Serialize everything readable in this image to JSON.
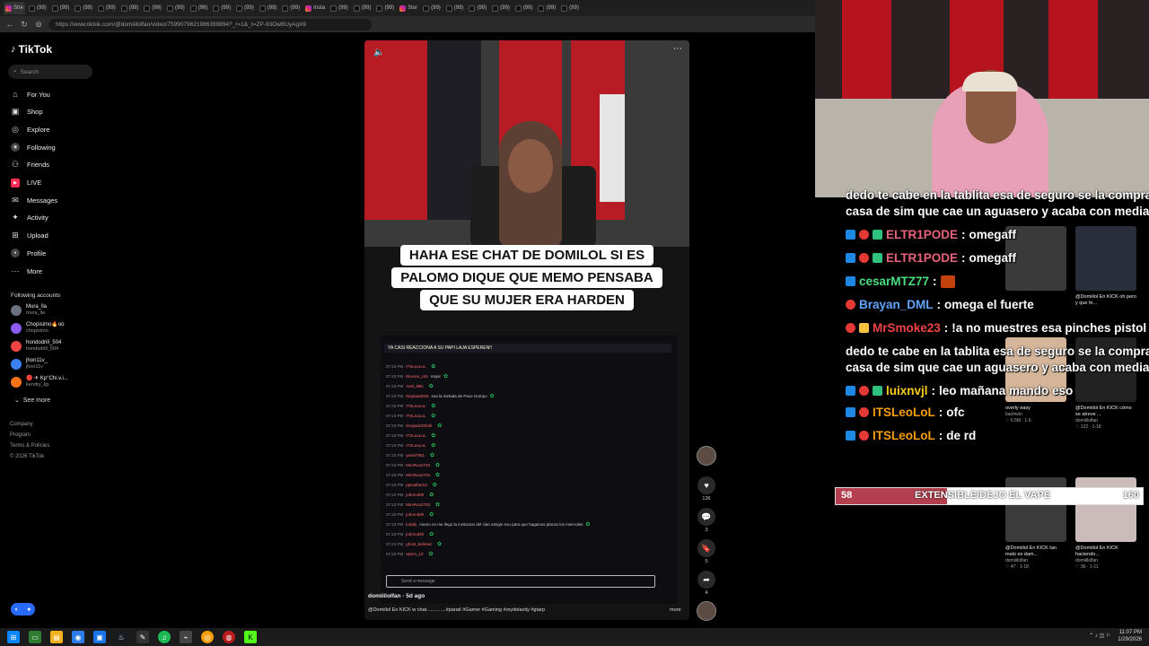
{
  "browser": {
    "tabs": [
      {
        "label": "Stre",
        "fav": "ig"
      },
      {
        "label": "(99)",
        "fav": "tt"
      },
      {
        "label": "(99)",
        "fav": "tt"
      },
      {
        "label": "(99)",
        "fav": "tt"
      },
      {
        "label": "(99)",
        "fav": "tt"
      },
      {
        "label": "(99)",
        "fav": "tt"
      },
      {
        "label": "(99)",
        "fav": "tt"
      },
      {
        "label": "(99)",
        "fav": "tt"
      },
      {
        "label": "(99)",
        "fav": "tt"
      },
      {
        "label": "(99)",
        "fav": "tt"
      },
      {
        "label": "(99)",
        "fav": "tt"
      },
      {
        "label": "(99)",
        "fav": "tt"
      },
      {
        "label": "(99)",
        "fav": "tt"
      },
      {
        "label": "Insta",
        "fav": "ig"
      },
      {
        "label": "(99)",
        "fav": "tt"
      },
      {
        "label": "(99)",
        "fav": "tt"
      },
      {
        "label": "(99)",
        "fav": "tt"
      },
      {
        "label": "Stor",
        "fav": "ig"
      },
      {
        "label": "(99)",
        "fav": "tt"
      },
      {
        "label": "(99)",
        "fav": "tt"
      },
      {
        "label": "(99)",
        "fav": "tt"
      },
      {
        "label": "(99)",
        "fav": "tt"
      },
      {
        "label": "(99)",
        "fav": "tt"
      },
      {
        "label": "(99)",
        "fav": "tt"
      },
      {
        "label": "(99)",
        "fav": "tt"
      }
    ],
    "url": "https://www.tiktok.com/@domiiilolfan/video/7599079621986399894?_r=1&_t=ZP-93OwBUyAgX9"
  },
  "sidebar": {
    "logo": "TikTok",
    "search_placeholder": "Search",
    "nav": [
      {
        "label": "For You",
        "icon": "home-icon",
        "glyph": "⌂"
      },
      {
        "label": "Shop",
        "icon": "shop-icon",
        "glyph": "▣"
      },
      {
        "label": "Explore",
        "icon": "compass-icon",
        "glyph": "◎"
      },
      {
        "label": "Following",
        "icon": "following-icon",
        "glyph": "◉"
      },
      {
        "label": "Friends",
        "icon": "friends-icon",
        "glyph": "⚇"
      },
      {
        "label": "LIVE",
        "icon": "live-icon",
        "glyph": "▶"
      },
      {
        "label": "Messages",
        "icon": "messages-icon",
        "glyph": "✉"
      },
      {
        "label": "Activity",
        "icon": "activity-icon",
        "glyph": "✦"
      },
      {
        "label": "Upload",
        "icon": "upload-icon",
        "glyph": "⊞"
      },
      {
        "label": "Profile",
        "icon": "profile-icon",
        "glyph": "●"
      },
      {
        "label": "More",
        "icon": "more-icon",
        "glyph": "⋯"
      }
    ],
    "following_title": "Following accounts",
    "accounts": [
      {
        "name": "Mura_lla",
        "handle": "mura_lla"
      },
      {
        "name": "Chopisimo🔥oo",
        "handle": "chopisimo"
      },
      {
        "name": "hondodrill_504",
        "handle": "hondodrill_504"
      },
      {
        "name": "jhon11v_",
        "handle": "jhon11v"
      },
      {
        "name": "🔴 ✈ Kp°Chi.v.i...",
        "handle": "kendry_kp"
      }
    ],
    "see_more": "See more",
    "footer": [
      "Company",
      "Program",
      "Terms & Policies",
      "© 2026 TikTok"
    ]
  },
  "video": {
    "caption_lines": [
      "HAHA ESE CHAT DE DOMILOL SI ES",
      "PALOMO DIQUE QUE MEMO PENSABA",
      "QUE SU MUJER ERA HARDEN"
    ],
    "chat_banner": "YA CASI REACCIONA A SU PAPI LAJA ESPEREN!!",
    "chat_lines": [
      {
        "t": "07:23 PM",
        "u": "ITSLeoLoL",
        "m": ""
      },
      {
        "t": "07:23 PM",
        "u": "Elcesar_csb",
        "m": "mejor"
      },
      {
        "t": "07:23 PM",
        "u": "Axel_99lc",
        "m": ""
      },
      {
        "t": "07:23 PM",
        "u": "Ninjaaa0028",
        "m": "esa la mirtada de Pace Gompo"
      },
      {
        "t": "07:23 PM",
        "u": "ITSLeoLoL",
        "m": ""
      },
      {
        "t": "07:23 PM",
        "u": "ITSLeoLoL",
        "m": ""
      },
      {
        "t": "07:23 PM",
        "u": "Dropatiz2004k",
        "m": ""
      },
      {
        "t": "07:23 PM",
        "u": "ITSLeoLoL",
        "m": ""
      },
      {
        "t": "07:23 PM",
        "u": "ITSLeoLoL",
        "m": ""
      },
      {
        "t": "07:23 PM",
        "u": "yeriel7951",
        "m": ""
      },
      {
        "t": "07:23 PM",
        "u": "MirvRoo2703",
        "m": ""
      },
      {
        "t": "07:23 PM",
        "u": "MirvRoo2703",
        "m": ""
      },
      {
        "t": "07:23 PM",
        "u": "pptvalbertot",
        "m": ""
      },
      {
        "t": "07:23 PM",
        "u": "juhrnnd9h",
        "m": ""
      },
      {
        "t": "07:23 PM",
        "u": "MirvRoo2703",
        "m": ""
      },
      {
        "t": "07:23 PM",
        "u": "juhrnnd9h",
        "m": ""
      },
      {
        "t": "07:23 PM",
        "u": "luisvlij",
        "m": "memo no me llego la invitacion del clan amiglo eso para que hagamos placas los miercoles"
      },
      {
        "t": "07:23 PM",
        "u": "juhrnnd9h",
        "m": ""
      },
      {
        "t": "07:23 PM",
        "u": "ghost_beltrear",
        "m": ""
      },
      {
        "t": "07:23 PM",
        "u": "wjmm_10",
        "m": ""
      }
    ],
    "msg_placeholder": "Send a message",
    "author": "domiiilolfan · 5d ago",
    "description": "@Domiilol En KICK w chat..............#paratí #Gamer #Gaming #reydelacity #gtarp",
    "more": "more"
  },
  "rail": {
    "likes": "136",
    "comments": "3",
    "saves": "5",
    "shares": "4"
  },
  "overlay_chat": [
    {
      "name": "",
      "msg": "dedo te cabe en la tablita esa de seguro se la compras",
      "badges": [],
      "color": "#ffffff"
    },
    {
      "name": "",
      "msg": "casa de sim que cae un aguasero y acaba con media is",
      "badges": [],
      "color": "#ffffff"
    },
    {
      "name": "ELTR1PODE",
      "msg": "omegaff",
      "badges": [
        "b1",
        "b2",
        "b3"
      ],
      "color": "#e8637b"
    },
    {
      "name": "ELTR1PODE",
      "msg": "omegaff",
      "badges": [
        "b1",
        "b2",
        "b3"
      ],
      "color": "#e8637b"
    },
    {
      "name": "cesarMTZ77",
      "msg": "",
      "badges": [
        "b1"
      ],
      "color": "#4ade80"
    },
    {
      "name": "Brayan_DML",
      "msg": "omega el fuerte",
      "badges": [
        "b2"
      ],
      "color": "#60a5fa"
    },
    {
      "name": "MrSmoke23",
      "msg": "!a no muestres esa pinches pistol",
      "badges": [
        "b2",
        "b4"
      ],
      "color": "#ef4444"
    },
    {
      "name": "",
      "msg": "dedo te cabe en la tablita esa de seguro se la compras",
      "badges": [],
      "color": "#ffffff"
    },
    {
      "name": "",
      "msg": "casa de sim que cae un aguasero y acaba con media is",
      "badges": [],
      "color": "#ffffff"
    },
    {
      "name": "luixnvjl",
      "msg": "leo mañana mando eso",
      "badges": [
        "b1",
        "b2",
        "b3"
      ],
      "color": "#facc15"
    },
    {
      "name": "ITSLeoLoL",
      "msg": "ofc",
      "badges": [
        "b1",
        "b2"
      ],
      "color": "#f59e0b"
    },
    {
      "name": "ITSLeoLoL",
      "msg": "de rd",
      "badges": [
        "b1",
        "b2"
      ],
      "color": "#f59e0b"
    }
  ],
  "goal": {
    "current": "58",
    "label": "EXTENSIBLE/DEJO EL VAPE",
    "max": "160",
    "progress": 0.3625
  },
  "grid": [
    {
      "title": "",
      "meta1": "♡ 1289 · 5d ago",
      "meta2": ""
    },
    {
      "title": "",
      "meta1": "♡ 113 · 1-15",
      "meta2": ""
    },
    {
      "title": "",
      "meta1": "",
      "meta2": ""
    },
    {
      "title": "@Domiilol En KICK oh pero y que fe...",
      "meta1": "",
      "meta2": ""
    },
    {
      "title": "overly easy",
      "meta1": "baohwin",
      "meta2": "♡ 6.5M · 1-6"
    },
    {
      "title": "@Domiilol En KICK cómo se atreve ...",
      "meta1": "domiiilolfan",
      "meta2": "♡ 122 · 1-18"
    },
    {
      "title": "@Domiilol En KICK tan malo es dam...",
      "meta1": "domiiilolfan",
      "meta2": "♡ 47 · 1-18"
    },
    {
      "title": "@Domiilol En KICK haciendo...",
      "meta1": "domiiilolfan",
      "meta2": "♡ 36 · 1-11"
    }
  ],
  "tray": {
    "time": "11:07 PM",
    "date": "1/29/2026"
  }
}
